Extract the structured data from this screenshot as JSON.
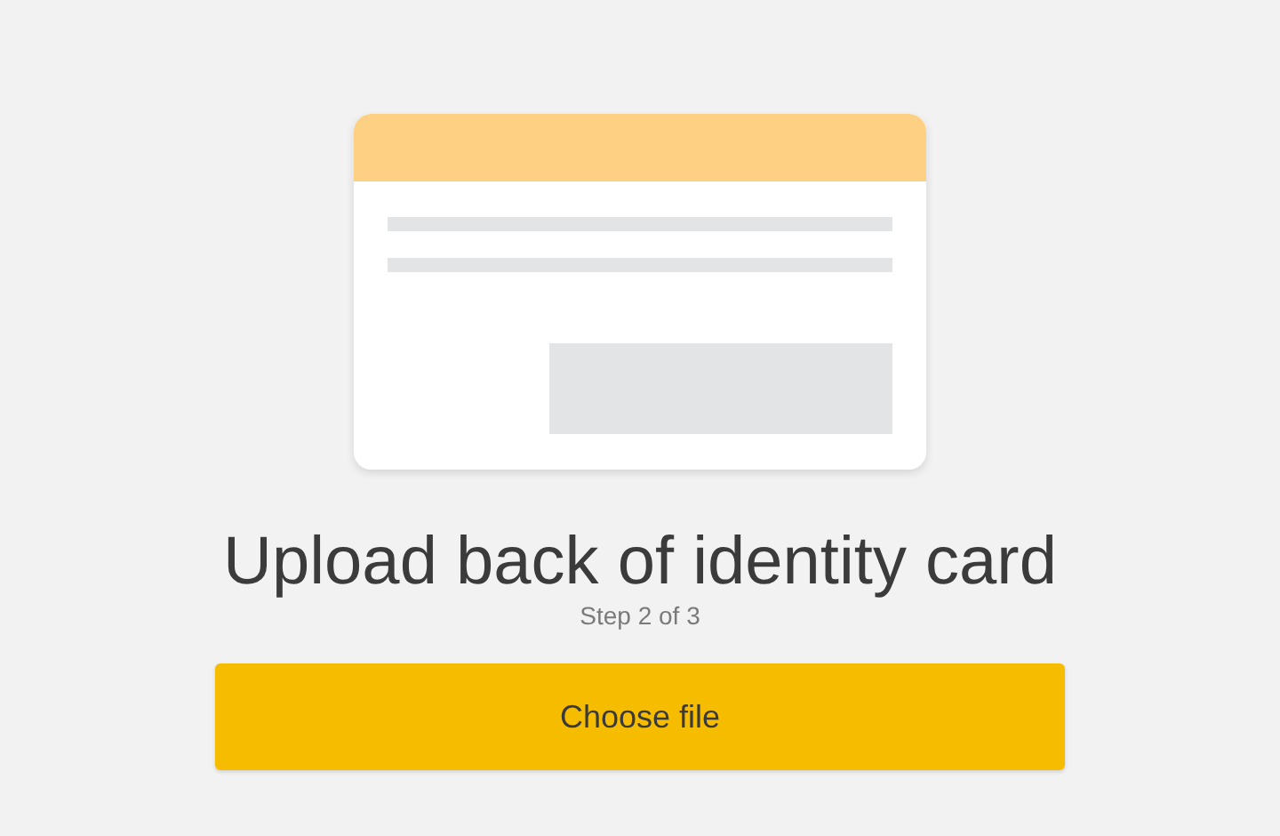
{
  "title": "Upload back of identity card",
  "step": "Step 2 of 3",
  "button": {
    "label": "Choose file"
  }
}
